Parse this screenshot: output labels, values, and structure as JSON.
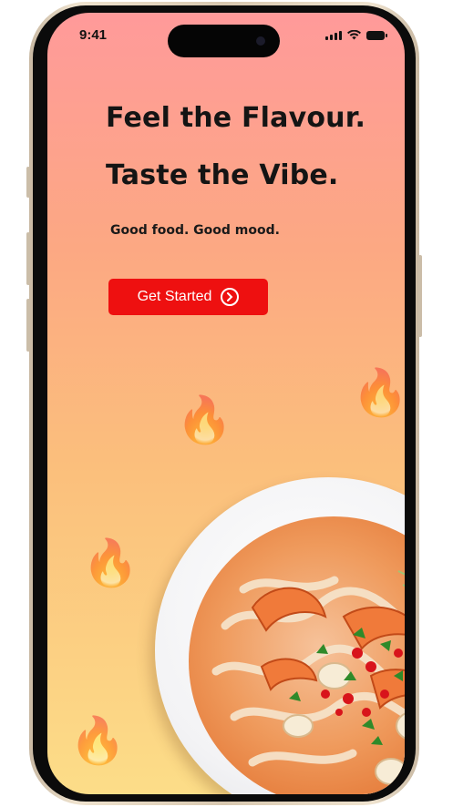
{
  "status_bar": {
    "time": "9:41"
  },
  "hero": {
    "headline_line1": "Feel the Flavour.",
    "headline_line2": "Taste the Vibe.",
    "tagline": "Good food. Good mood."
  },
  "cta": {
    "label": "Get Started",
    "icon": "chevron-right-circle-icon",
    "color": "#ee1010"
  },
  "background": {
    "gradient_top": "#ff9a9a",
    "gradient_bottom": "#fcdd88"
  },
  "decor": {
    "icon": "fire-emoji",
    "glyph": "🔥"
  },
  "image": {
    "subject": "noodle soup bowl"
  }
}
